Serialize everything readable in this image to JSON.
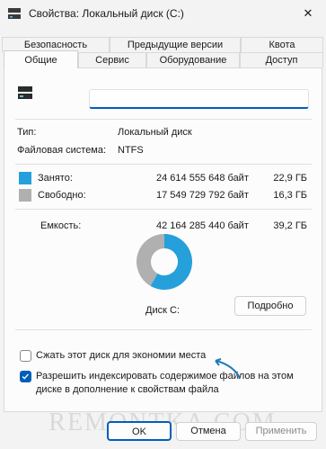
{
  "window": {
    "title": "Свойства: Локальный диск (C:)",
    "close_symbol": "✕",
    "title_icon": "drive-icon",
    "close_icon": "close-icon"
  },
  "tabs": {
    "row1": [
      "Безопасность",
      "Предыдущие версии",
      "Квота"
    ],
    "row2": [
      "Общие",
      "Сервис",
      "Оборудование",
      "Доступ"
    ],
    "active": "Общие"
  },
  "general": {
    "name_value": "",
    "type_label": "Тип:",
    "type_value": "Локальный диск",
    "fs_label": "Файловая система:",
    "fs_value": "NTFS",
    "used": {
      "label": "Занято:",
      "bytes": "24 614 555 648 байт",
      "size": "22,9 ГБ",
      "color": "#26a0da"
    },
    "free": {
      "label": "Свободно:",
      "bytes": "17 549 729 792 байт",
      "size": "16,3 ГБ",
      "color": "#b0b0b0"
    },
    "capacity": {
      "label": "Емкость:",
      "bytes": "42 164 285 440 байт",
      "size": "39,2 ГБ"
    },
    "disk_label": "Диск C:",
    "details_button": "Подробно",
    "compress_label": "Сжать этот диск для экономии места",
    "compress_checked": false,
    "index_label_line1": "Разрешить индексировать содержимое файлов на этом",
    "index_label_line2": "диске в дополнение к свойствам файла",
    "index_checked": true
  },
  "chart_data": {
    "type": "pie",
    "categories": [
      "Занято:",
      "Свободно:"
    ],
    "values": [
      24614555648,
      17549729792
    ],
    "colors": [
      "#26a0da",
      "#b0b0b0"
    ]
  },
  "buttons": {
    "ok": "OK",
    "cancel": "Отмена",
    "apply": "Применить"
  },
  "watermark": "REMONTKA.COM",
  "accent_color": "#005fb8",
  "annotation_arrow_color": "#1f7ab8"
}
